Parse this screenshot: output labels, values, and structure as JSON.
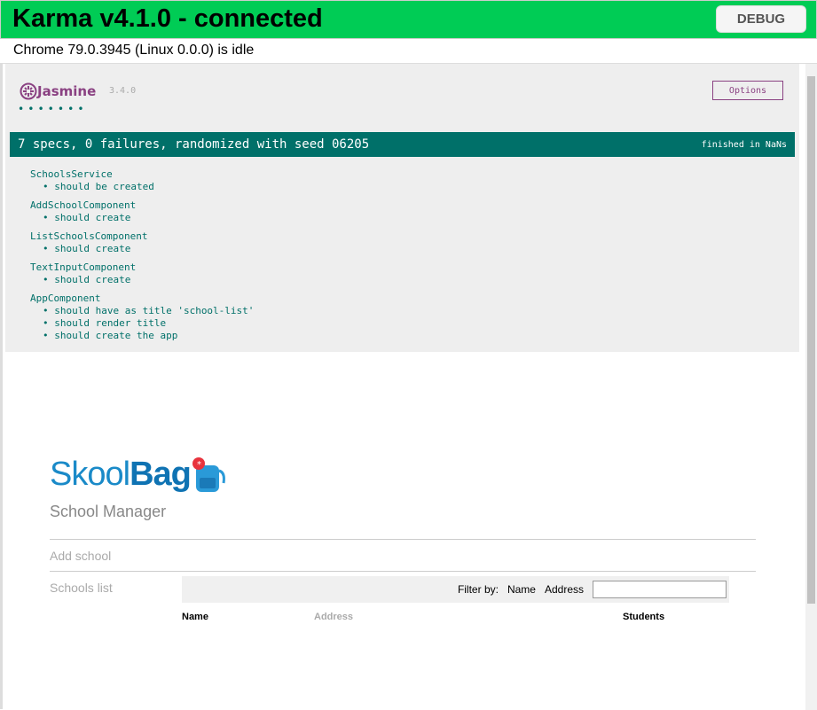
{
  "karma": {
    "title": "Karma v4.1.0 - connected",
    "debug_label": "DEBUG",
    "status": "Chrome 79.0.3945 (Linux 0.0.0) is idle"
  },
  "jasmine": {
    "name": "Jasmine",
    "version": "3.4.0",
    "options_label": "Options",
    "dots": "•••••••",
    "summary": "7 specs, 0 failures, randomized with seed 06205",
    "duration": "finished in NaNs",
    "suites": [
      {
        "name": "SchoolsService",
        "specs": [
          "should be created"
        ]
      },
      {
        "name": "AddSchoolComponent",
        "specs": [
          "should create"
        ]
      },
      {
        "name": "ListSchoolsComponent",
        "specs": [
          "should create"
        ]
      },
      {
        "name": "TextInputComponent",
        "specs": [
          "should create"
        ]
      },
      {
        "name": "AppComponent",
        "specs": [
          "should have as title 'school-list'",
          "should render title",
          "should create the app"
        ]
      }
    ],
    "colors": {
      "pass": "#007069",
      "brand": "#8a4182"
    }
  },
  "app": {
    "logo_light": "Skool",
    "logo_bold": "Bag",
    "subtitle": "School Manager",
    "add_school": "Add school",
    "schools_list": "Schools list",
    "filter": {
      "label": "Filter by:",
      "name": "Name",
      "address": "Address",
      "value": ""
    },
    "columns": [
      "Name",
      "Address",
      "Students"
    ]
  }
}
